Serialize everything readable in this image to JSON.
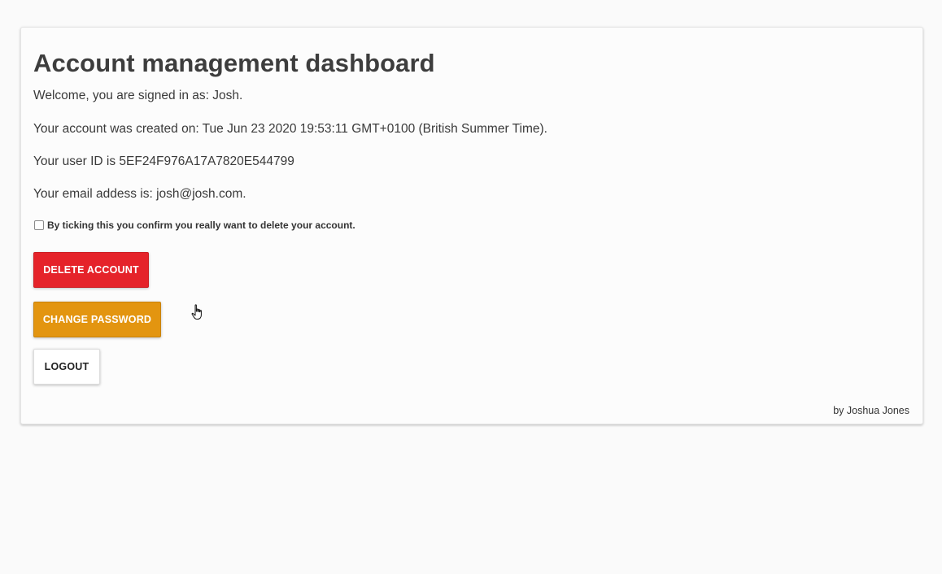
{
  "dashboard": {
    "title": "Account management dashboard",
    "welcome": "Welcome, you are signed in as: Josh.",
    "created": "Your account was created on: Tue Jun 23 2020 19:53:11 GMT+0100 (British Summer Time).",
    "user_id": "Your user ID is 5EF24F976A17A7820E544799",
    "email": "Your email addess is: josh@josh.com.",
    "confirm_label": "By ticking this you confirm you really want to delete your account.",
    "confirm_checked": false
  },
  "buttons": {
    "delete_label": "DELETE ACCOUNT",
    "change_password_label": "CHANGE PASSWORD",
    "logout_label": "LOGOUT"
  },
  "footer": {
    "credit": "by Joshua Jones"
  },
  "icons": {
    "cursor": "hand-pointer-icon"
  },
  "colors": {
    "delete": "#e5232a",
    "change_password": "#e39510",
    "logout": "#ffffff",
    "page_background": "#fafafa"
  }
}
